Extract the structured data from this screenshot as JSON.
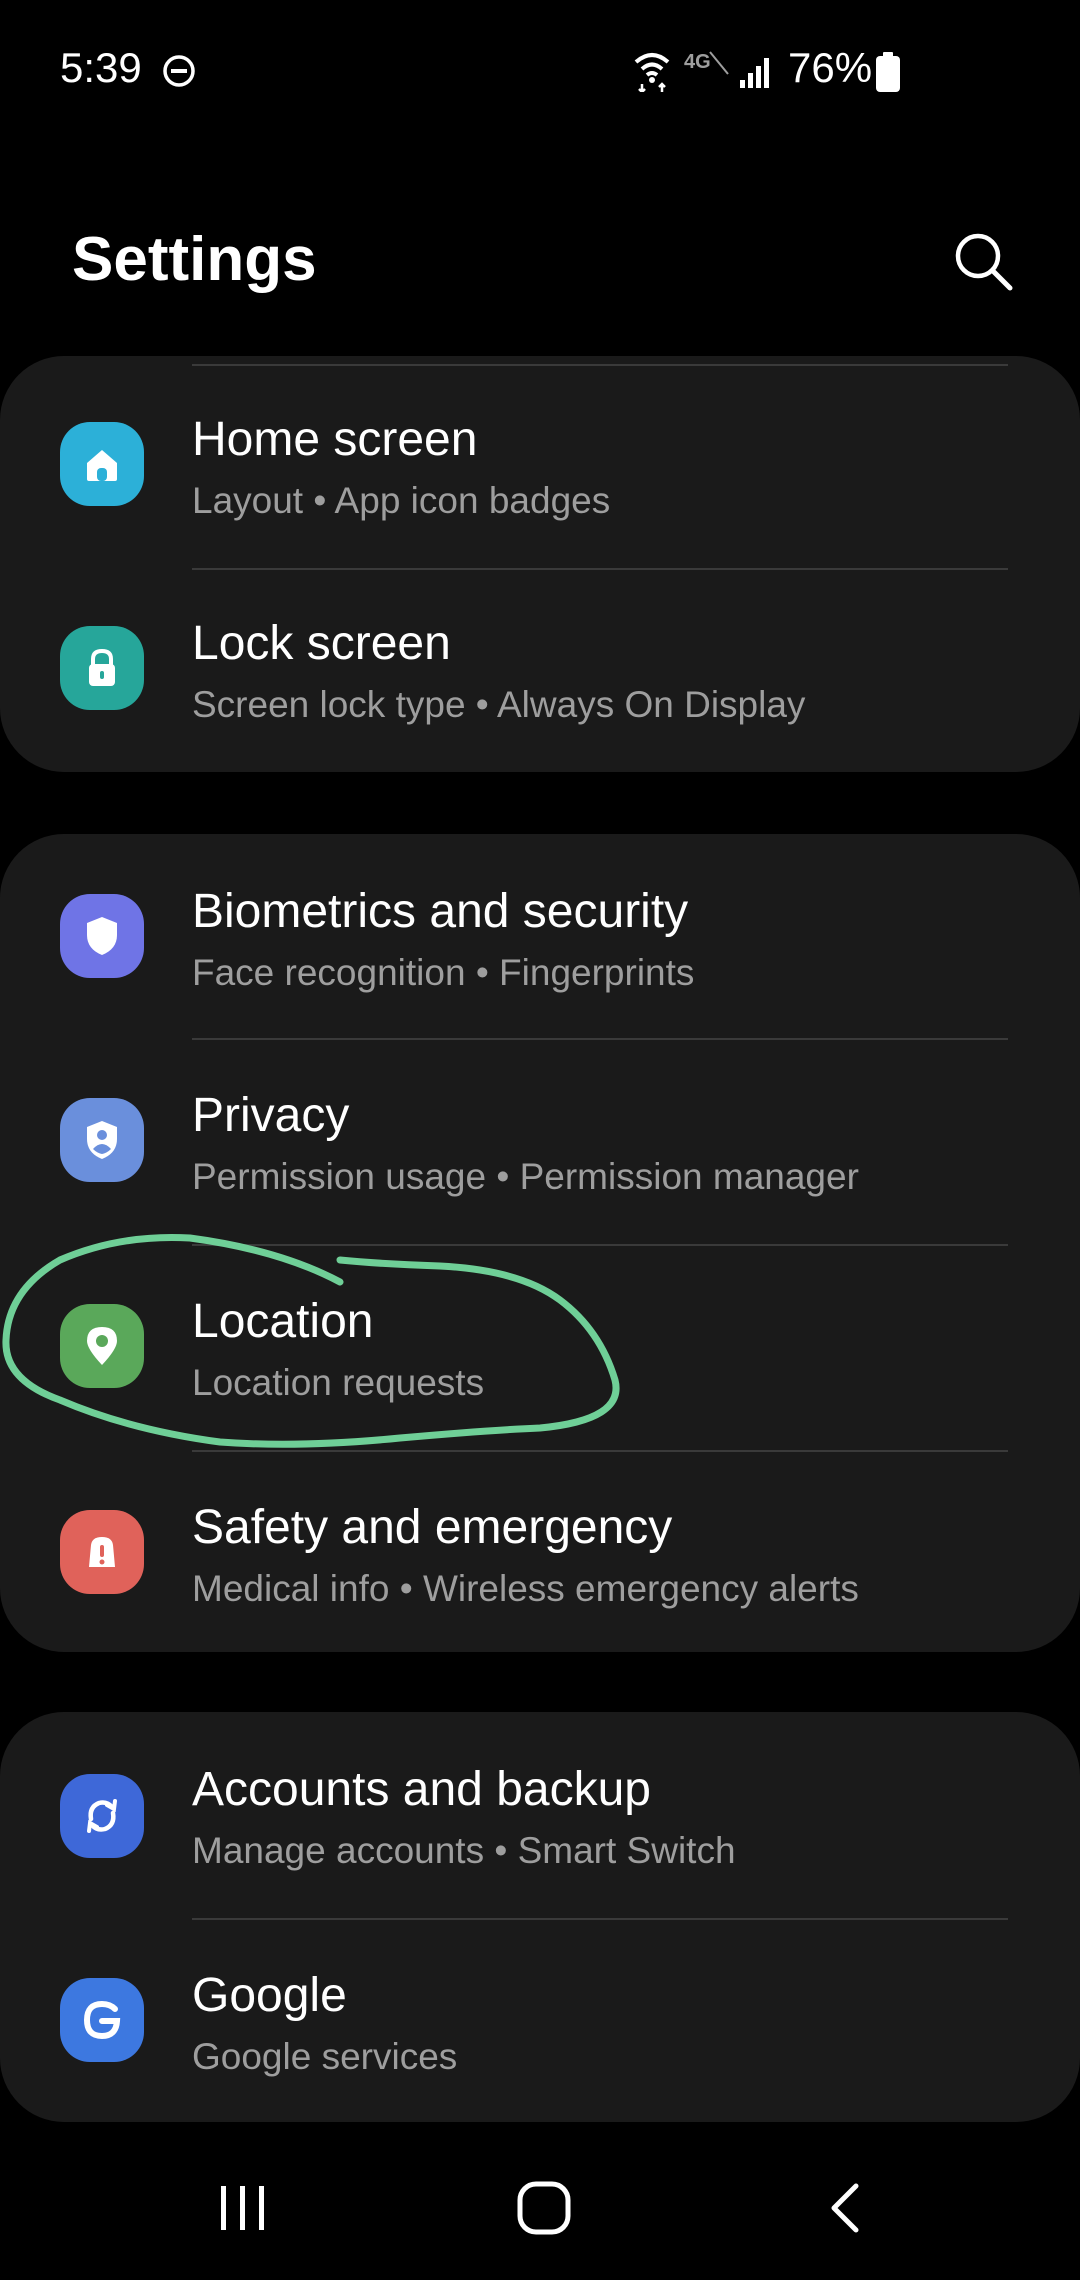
{
  "status_bar": {
    "time": "5:39",
    "battery": "76%",
    "network_label": "4G"
  },
  "header": {
    "title": "Settings"
  },
  "cards": [
    {
      "items": [
        {
          "title": "Home screen",
          "subtitle": "Layout  •  App icon badges",
          "icon": "home-icon",
          "color": "#2cb0d8"
        },
        {
          "title": "Lock screen",
          "subtitle": "Screen lock type  •  Always On Display",
          "icon": "lock-icon",
          "color": "#26a69a"
        }
      ]
    },
    {
      "items": [
        {
          "title": "Biometrics and security",
          "subtitle": "Face recognition  •  Fingerprints",
          "icon": "shield-icon",
          "color": "#6f74e6"
        },
        {
          "title": "Privacy",
          "subtitle": "Permission usage  •  Permission manager",
          "icon": "privacy-shield-icon",
          "color": "#6a8fdc"
        },
        {
          "title": "Location",
          "subtitle": "Location requests",
          "icon": "location-pin-icon",
          "color": "#5aa85a"
        },
        {
          "title": "Safety and emergency",
          "subtitle": "Medical info  •  Wireless emergency alerts",
          "icon": "alert-icon",
          "color": "#e0625a"
        }
      ]
    },
    {
      "items": [
        {
          "title": "Accounts and backup",
          "subtitle": "Manage accounts  •  Smart Switch",
          "icon": "sync-icon",
          "color": "#3e68d8"
        },
        {
          "title": "Google",
          "subtitle": "Google services",
          "icon": "google-g-icon",
          "color": "#3d78e0"
        }
      ]
    }
  ],
  "annotation": {
    "color": "#6fcf97",
    "target": "Location"
  },
  "nav_bar": {
    "buttons": [
      "recents-icon",
      "home-button-icon",
      "back-icon"
    ]
  }
}
